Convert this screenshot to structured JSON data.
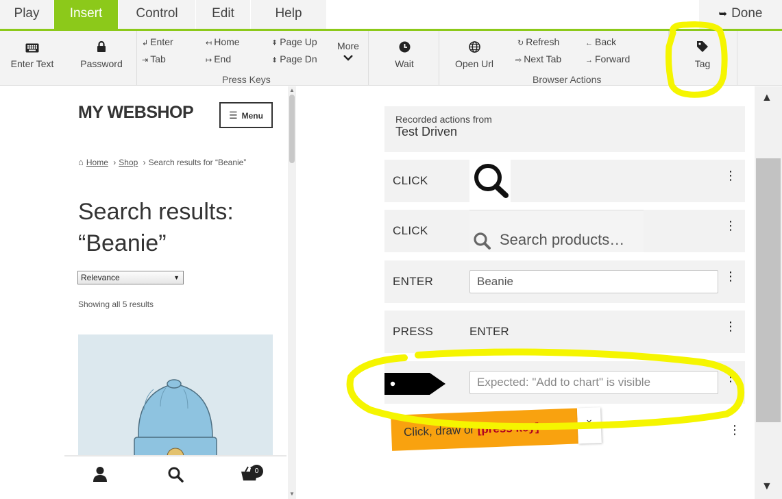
{
  "menubar": {
    "tabs": [
      {
        "label": "Play"
      },
      {
        "label": "Insert"
      },
      {
        "label": "Control"
      },
      {
        "label": "Edit"
      },
      {
        "label": "Help"
      }
    ],
    "done_label": "Done",
    "accent": "#8cc91a"
  },
  "toolbar": {
    "enter_text": "Enter Text",
    "password": "Password",
    "keys": {
      "enter": "Enter",
      "tab": "Tab",
      "home": "Home",
      "end": "End",
      "page_up": "Page Up",
      "page_dn": "Page Dn",
      "caption": "Press Keys"
    },
    "more": "More",
    "wait": "Wait",
    "open_url": "Open Url",
    "browser": {
      "refresh": "Refresh",
      "back": "Back",
      "next_tab": "Next Tab",
      "forward": "Forward",
      "caption": "Browser Actions"
    },
    "tag": "Tag"
  },
  "preview": {
    "logo": "MY WEBSHOP",
    "menu_label": "Menu",
    "breadcrumb": {
      "home": "Home",
      "shop": "Shop",
      "current": "Search results for “Beanie”"
    },
    "title_line1": "Search results:",
    "title_line2": "“Beanie”",
    "sort_value": "Relevance",
    "showing": "Showing all 5 results",
    "cart_count": "0"
  },
  "recorder": {
    "header_line1": "Recorded actions from",
    "header_line2": "Test Driven",
    "steps": [
      {
        "command": "CLICK"
      },
      {
        "command": "CLICK",
        "thumb_text": "Search products…"
      },
      {
        "command": "ENTER",
        "value": "Beanie"
      },
      {
        "command": "PRESS",
        "value": "ENTER"
      },
      {
        "placeholder": "Expected: \"Add to chart\" is visible"
      }
    ],
    "hint_prefix": "Click, draw or ",
    "hint_key": "[press key]",
    "hint_close": "×"
  },
  "icons": {
    "keyboard": "keyboard-icon",
    "lock": "lock-icon",
    "clock": "clock-icon",
    "globe": "globe-icon",
    "tag": "tag-icon",
    "done": "sign-out-icon"
  },
  "highlight_color": "#f5f500"
}
